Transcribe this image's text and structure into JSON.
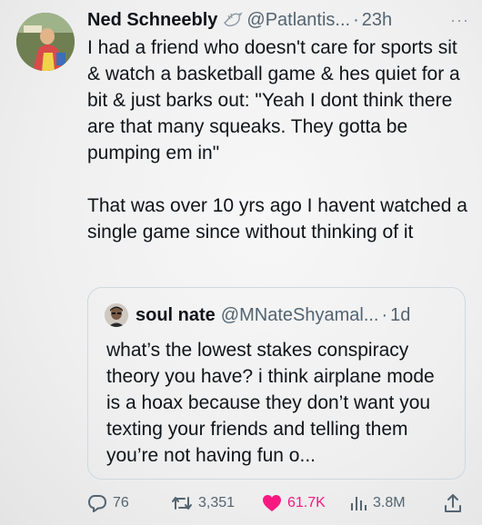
{
  "tweet": {
    "author_name": "Ned Schneebly",
    "author_handle": "@Patlantis...",
    "separator": "·",
    "time": "23h",
    "more": "···",
    "paragraphs": [
      "I had a friend who doesn't care for sports sit & watch a basketball game & hes quiet for a bit & just barks out: \"Yeah I dont think there are that many squeaks. They gotta be pumping em in\"",
      "That was over 10 yrs ago I havent watched a single game since without thinking of it"
    ]
  },
  "quoted": {
    "author_name": "soul nate",
    "author_handle": "@MNateShyamal...",
    "separator": "·",
    "time": "1d",
    "text": "what’s the lowest stakes conspiracy theory you have? i think airplane mode is a hoax because they don’t want you texting your friends and telling them you’re not having fun o..."
  },
  "actions": {
    "replies": "76",
    "reposts": "3,351",
    "likes": "61.7K",
    "views": "3.8M"
  },
  "colors": {
    "text": "#0f1419",
    "secondary": "#536471",
    "like": "#f91880",
    "border": "#cfd9de"
  },
  "icons": [
    "reply-icon",
    "repost-icon",
    "like-icon",
    "views-icon",
    "share-icon",
    "bird-icon",
    "more-icon"
  ]
}
